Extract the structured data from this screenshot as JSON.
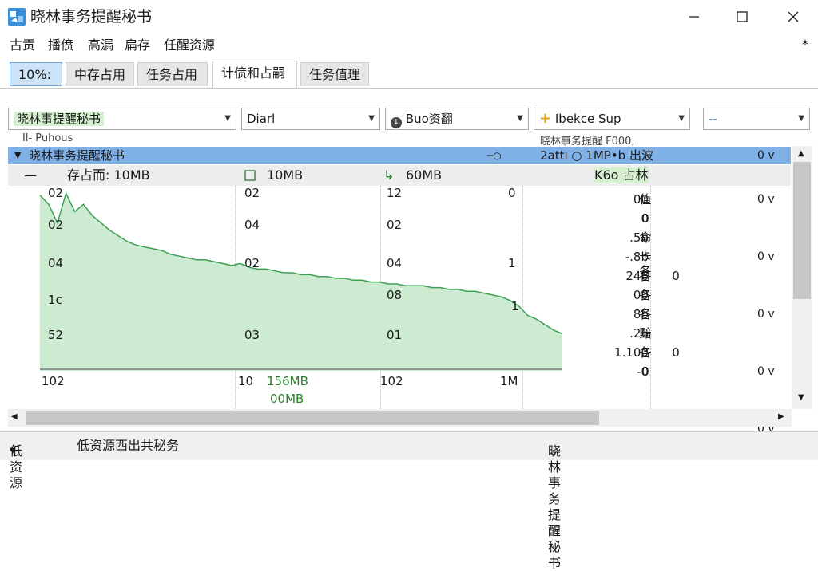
{
  "window": {
    "title": "晓林事务提醒秘书",
    "menu_extra": "*"
  },
  "menu": [
    "古贡",
    "播偾",
    "高漏",
    "扁存",
    "任醒资源"
  ],
  "tabs": [
    "10%:",
    "中存占用",
    "任务占用",
    "计偾和占嗣",
    "任务值理"
  ],
  "filters": {
    "dd1": "晓林事提醒秘书",
    "dd2": "Diarl",
    "dd3": "Buo资翻",
    "dd4": "Ibekce Sup",
    "dd5": "--"
  },
  "header_strip": {
    "c1": "Il- Puhous",
    "c2": "晓林事务提醒 F000,"
  },
  "group_row": {
    "label": "晓林事务提醒秘书",
    "mid": "─○",
    "info": "2attı  ○  1MP•b 出波",
    "right": "0 ⅴ"
  },
  "sub_row": {
    "c1": "存占而:  10MB",
    "c2": "10MB",
    "c3": "60MB",
    "c4": "K6o 占林"
  },
  "chart_cols": {
    "col1": [
      "02",
      "02",
      "04",
      "1c",
      "52",
      "102"
    ],
    "col2": [
      "02",
      "04",
      "02",
      "03",
      "10"
    ],
    "col3": [
      "12",
      "02",
      "04",
      "08",
      "01",
      "102"
    ],
    "col4": [
      "0",
      "1",
      "1",
      "1M"
    ]
  },
  "bottom_mb": [
    "156MB",
    "00MB"
  ],
  "right_values": [
    "00",
    "0",
    ".5b",
    "-.8b",
    "246",
    "00",
    "8b",
    ".26",
    "1.100",
    "-0"
  ],
  "right_values2": [
    "值",
    "0",
    "命",
    "卡\n各",
    "各",
    "各",
    "各",
    "黯",
    "各",
    "0"
  ],
  "right_values3": [
    "",
    "",
    "",
    "",
    "0",
    "",
    "",
    "",
    "0",
    ""
  ],
  "right_dropdowns": [
    "0 ⅴ",
    "0 ⅴ",
    "0 ⅴ",
    "0 ⅴ",
    "0 ⅴ"
  ],
  "status": {
    "left": "低资源",
    "left_text": "低资源西出共秘务",
    "right": "晓林事务提醒秘书"
  },
  "chart_data": {
    "type": "area",
    "x": [
      0,
      1,
      2,
      3,
      4,
      5,
      6,
      7,
      8,
      9,
      10,
      11,
      12,
      13,
      14,
      15,
      16,
      17,
      18,
      19,
      20,
      21,
      22,
      23,
      24,
      25,
      26,
      27,
      28,
      29,
      30,
      31,
      32,
      33,
      34,
      35,
      36,
      37,
      38,
      39,
      40,
      41,
      42,
      43,
      44,
      45,
      46,
      47,
      48,
      49,
      50,
      51,
      52,
      53,
      54,
      55,
      56,
      57,
      58,
      59,
      60
    ],
    "series": [
      {
        "values": [
          95,
          90,
          80,
          96,
          86,
          90,
          84,
          80,
          76,
          73,
          70,
          68,
          67,
          66,
          65,
          63,
          62,
          61,
          60,
          60,
          59,
          58,
          57,
          58,
          56,
          55,
          55,
          54,
          53,
          53,
          52,
          52,
          51,
          51,
          50,
          50,
          49,
          49,
          48,
          48,
          47,
          47,
          46,
          46,
          46,
          45,
          45,
          44,
          44,
          43,
          43,
          42,
          41,
          40,
          38,
          35,
          30,
          28,
          25,
          22,
          20
        ]
      }
    ],
    "ylim": [
      0,
      100
    ],
    "colors": {
      "fill": "#cdebd1",
      "line": "#3f9f53"
    }
  }
}
